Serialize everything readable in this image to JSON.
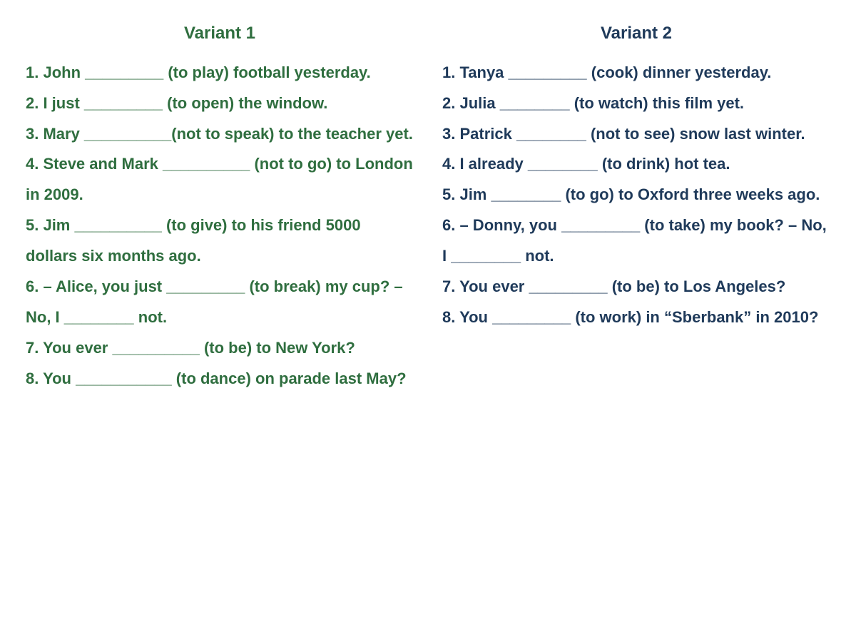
{
  "variants": [
    {
      "title": "Variant 1",
      "items": [
        "1. John _________ (to play) football yesterday.",
        "2. I just _________ (to open) the window.",
        "3. Mary __________(not to speak) to the teacher yet.",
        "4. Steve and Mark __________ (not to go) to London in 2009.",
        "5. Jim __________ (to give) to his friend 5000 dollars six months ago.",
        "6. – Alice, you just _________ (to break) my cup? – No, I ________ not.",
        "7. You ever __________ (to be) to New York?",
        "8. You ___________ (to dance) on parade last May?"
      ]
    },
    {
      "title": "Variant 2",
      "items": [
        "1. Tanya _________ (cook) dinner yesterday.",
        "2. Julia ________ (to watch) this film yet.",
        "3. Patrick ________ (not to see) snow last winter.",
        "4. I already ________ (to drink) hot tea.",
        "5. Jim ________ (to go) to Oxford three weeks ago.",
        "6. – Donny, you _________ (to take) my book? – No, I ________ not.",
        "7. You ever _________ (to be) to Los Angeles?",
        "8. You _________ (to work) in “Sberbank” in 2010?"
      ]
    }
  ]
}
